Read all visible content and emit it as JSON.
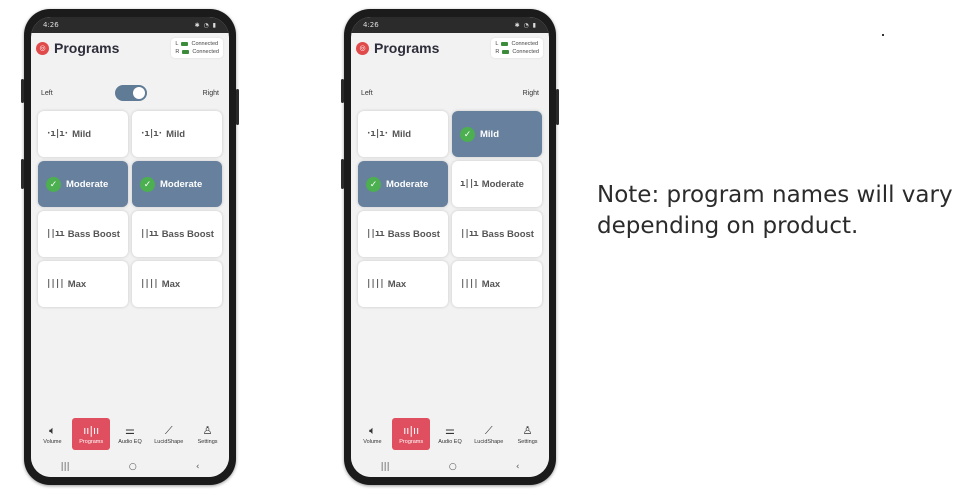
{
  "phones": [
    {
      "status_time": "4:26",
      "title": "Programs",
      "connection": {
        "left": "L",
        "right": "R",
        "left_status": "Connected",
        "right_status": "Connected"
      },
      "toggle": {
        "left_label": "Left",
        "right_label": "Right",
        "state": "right"
      },
      "programs": [
        {
          "label": "Mild",
          "wave": "·ı|ı·",
          "selected": false
        },
        {
          "label": "Mild",
          "wave": "·ı|ı·",
          "selected": false
        },
        {
          "label": "Moderate",
          "wave": "",
          "selected": true
        },
        {
          "label": "Moderate",
          "wave": "",
          "selected": true
        },
        {
          "label": "Bass Boost",
          "wave": "||ıı",
          "selected": false
        },
        {
          "label": "Bass Boost",
          "wave": "||ıı",
          "selected": false
        },
        {
          "label": "Max",
          "wave": "||||",
          "selected": false
        },
        {
          "label": "Max",
          "wave": "||||",
          "selected": false
        }
      ],
      "nav": [
        {
          "label": "Volume",
          "icon": "speaker-icon",
          "active": false
        },
        {
          "label": "Programs",
          "icon": "waveform-icon",
          "active": true
        },
        {
          "label": "Audio EQ",
          "icon": "sliders-icon",
          "active": false
        },
        {
          "label": "LucidShape",
          "icon": "chart-icon",
          "active": false
        },
        {
          "label": "Settings",
          "icon": "person-icon",
          "active": false
        }
      ],
      "sys_nav": [
        "|||",
        "○",
        "‹"
      ]
    },
    {
      "status_time": "4:26",
      "title": "Programs",
      "connection": {
        "left": "L",
        "right": "R",
        "left_status": "Connected",
        "right_status": "Connected"
      },
      "toggle": {
        "left_label": "Left",
        "right_label": "Right",
        "state": "hidden"
      },
      "programs": [
        {
          "label": "Mild",
          "wave": "·ı|ı·",
          "selected": false
        },
        {
          "label": "Mild",
          "wave": "",
          "selected": true
        },
        {
          "label": "Moderate",
          "wave": "",
          "selected": true
        },
        {
          "label": "Moderate",
          "wave": "ı||ı",
          "selected": false
        },
        {
          "label": "Bass Boost",
          "wave": "||ıı",
          "selected": false
        },
        {
          "label": "Bass Boost",
          "wave": "||ıı",
          "selected": false
        },
        {
          "label": "Max",
          "wave": "||||",
          "selected": false
        },
        {
          "label": "Max",
          "wave": "||||",
          "selected": false
        }
      ],
      "nav": [
        {
          "label": "Volume",
          "icon": "speaker-icon",
          "active": false
        },
        {
          "label": "Programs",
          "icon": "waveform-icon",
          "active": true
        },
        {
          "label": "Audio EQ",
          "icon": "sliders-icon",
          "active": false
        },
        {
          "label": "LucidShape",
          "icon": "chart-icon",
          "active": false
        },
        {
          "label": "Settings",
          "icon": "person-icon",
          "active": false
        }
      ],
      "sys_nav": [
        "|||",
        "○",
        "‹"
      ]
    }
  ],
  "note": "Note: program names will vary depending on product.",
  "colors": {
    "selected_tile": "#66809d",
    "active_nav": "#e04f5f",
    "check": "#4caf50",
    "logo": "#e04a4a"
  }
}
